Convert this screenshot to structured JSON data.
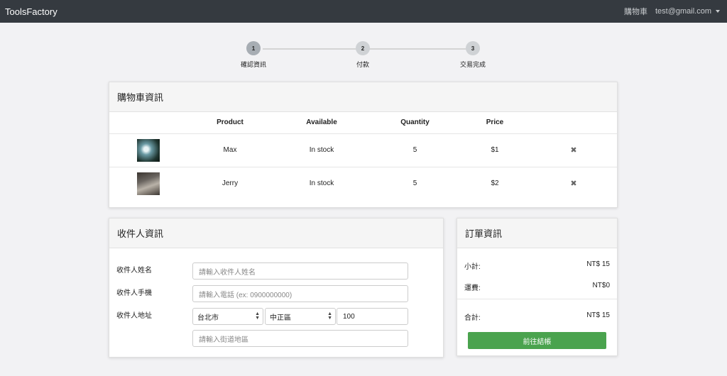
{
  "navbar": {
    "brand": "ToolsFactory",
    "cart_link": "購物車",
    "user_email": "test@gmail.com"
  },
  "steps": [
    {
      "number": "1",
      "label": "確認資訊",
      "active": true
    },
    {
      "number": "2",
      "label": "付款",
      "active": false
    },
    {
      "number": "3",
      "label": "交易完成",
      "active": false
    }
  ],
  "cart": {
    "title": "購物車資訊",
    "columns": [
      "Product",
      "Available",
      "Quantity",
      "Price"
    ],
    "items": [
      {
        "name": "Max",
        "available": "In stock",
        "quantity": "5",
        "price": "$1",
        "remove_icon": "✖"
      },
      {
        "name": "Jerry",
        "available": "In stock",
        "quantity": "5",
        "price": "$2",
        "remove_icon": "✖"
      }
    ]
  },
  "recipient": {
    "title": "收件人資訊",
    "name_label": "收件人姓名",
    "name_placeholder": "請輸入收件人姓名",
    "phone_label": "收件人手機",
    "phone_placeholder": "請輸入電話 (ex: 0900000000)",
    "address_label": "收件人地址",
    "city": "台北市",
    "district": "中正區",
    "zip": "100",
    "street_placeholder": "請輸入街道地區"
  },
  "order": {
    "title": "訂單資訊",
    "subtotal_label": "小計:",
    "subtotal_value": "NT$ 15",
    "shipping_label": "運費:",
    "shipping_value": "NT$0",
    "total_label": "合計:",
    "total_value": "NT$ 15",
    "checkout_label": "前往結帳"
  },
  "colors": {
    "navbar": "#353a40",
    "checkout": "#4aa34e",
    "background": "#f2f2f4"
  }
}
